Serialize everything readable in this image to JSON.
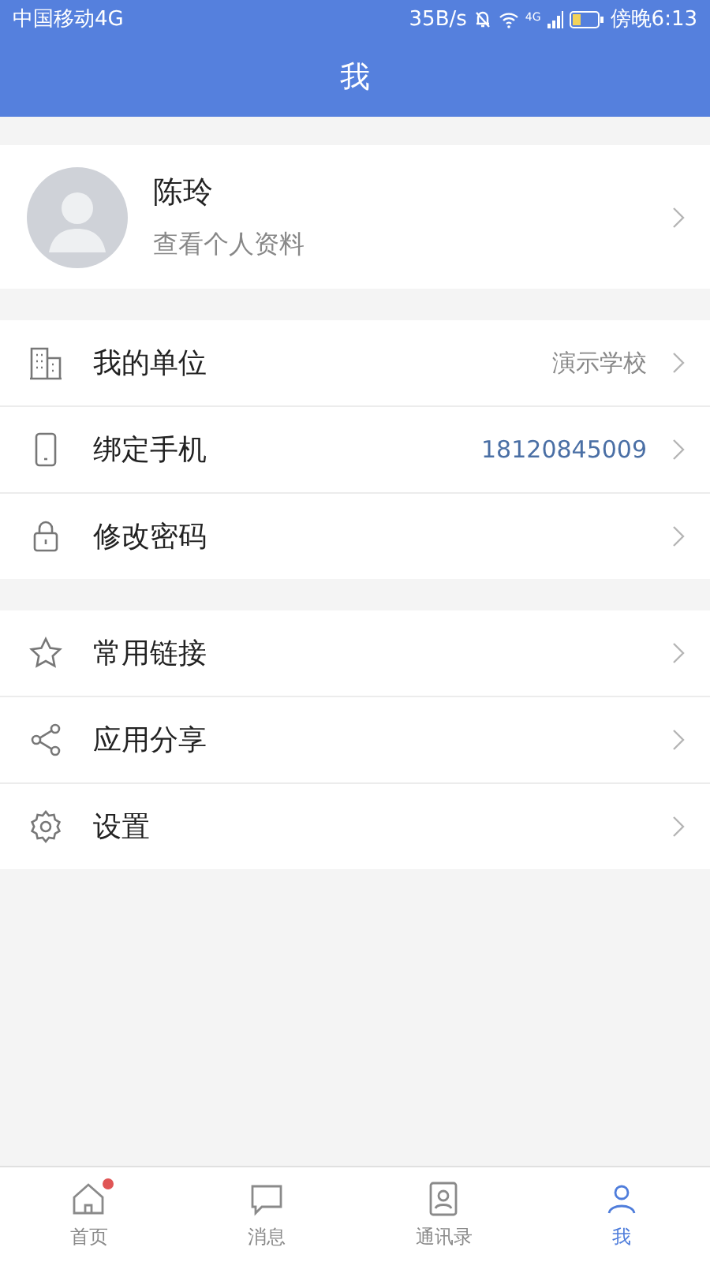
{
  "status_bar": {
    "carrier": "中国移动4G",
    "speed": "35B/s",
    "network": "4G",
    "time": "傍晚6:13"
  },
  "header": {
    "title": "我"
  },
  "profile": {
    "name": "陈玲",
    "subtitle": "查看个人资料"
  },
  "groups": [
    {
      "items": [
        {
          "kind": "building",
          "label": "我的单位",
          "value": "演示学校",
          "highlighted": false
        },
        {
          "kind": "phone",
          "label": "绑定手机",
          "value": "18120845009",
          "highlighted": true
        },
        {
          "kind": "lock",
          "label": "修改密码"
        }
      ]
    },
    {
      "items": [
        {
          "kind": "star",
          "label": "常用链接"
        },
        {
          "kind": "share",
          "label": "应用分享"
        },
        {
          "kind": "gear",
          "label": "设置"
        }
      ]
    }
  ],
  "tab_bar": [
    {
      "kind": "home",
      "label": "首页",
      "selected": false,
      "badge": true
    },
    {
      "kind": "chat",
      "label": "消息",
      "selected": false,
      "badge": false
    },
    {
      "kind": "contacts",
      "label": "通讯录",
      "selected": false,
      "badge": false
    },
    {
      "kind": "person",
      "label": "我",
      "selected": true,
      "badge": false
    }
  ]
}
